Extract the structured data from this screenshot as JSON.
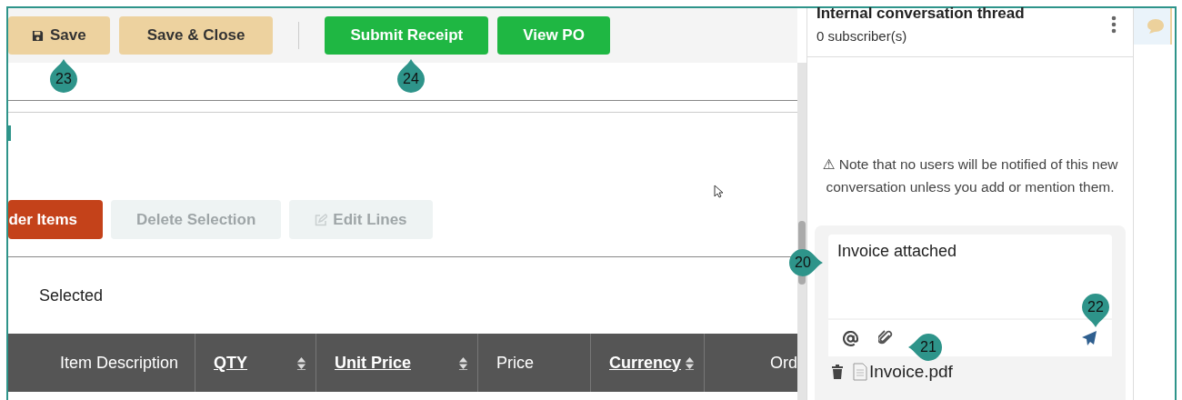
{
  "toolbar": {
    "buttons": [
      {
        "label": "Save",
        "kind": "secondary"
      },
      {
        "label": "Save & Close",
        "kind": "secondary"
      },
      {
        "label": "Submit Receipt",
        "kind": "primary"
      },
      {
        "label": "View PO",
        "kind": "primary"
      }
    ]
  },
  "actions": [
    {
      "label": "der Items",
      "kind": "danger",
      "disabled": false
    },
    {
      "label": "Delete Selection",
      "kind": "plain",
      "disabled": true
    },
    {
      "label": "Edit Lines",
      "kind": "plain",
      "disabled": true
    }
  ],
  "selection": {
    "label": "Selected"
  },
  "table": {
    "columns": [
      {
        "label": "Item Description",
        "sortable": false
      },
      {
        "label": "QTY",
        "sortable": true
      },
      {
        "label": "Unit Price",
        "sortable": true
      },
      {
        "label": "Price",
        "sortable": false
      },
      {
        "label": "Currency",
        "sortable": true
      },
      {
        "label": "Ord",
        "sortable": false
      }
    ]
  },
  "conversation": {
    "title": "Internal conversation thread",
    "subscribers": "0 subscriber(s)",
    "note": "⚠ Note that no users will be notified of this new conversation unless you add or mention them.",
    "message": "Invoice attached",
    "attachment": "Invoice.pdf"
  },
  "callouts": [
    {
      "number": "23",
      "kind": "up"
    },
    {
      "number": "24",
      "kind": "up"
    },
    {
      "number": "20",
      "kind": "right"
    },
    {
      "number": "21",
      "kind": "left"
    },
    {
      "number": "22",
      "kind": "down"
    }
  ]
}
